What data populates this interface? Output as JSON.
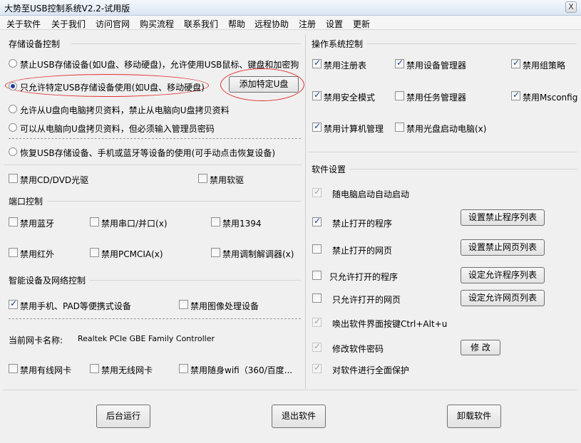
{
  "window": {
    "title": "大势至USB控制系统V2.2-试用版",
    "close": "X"
  },
  "menu": [
    "关于软件",
    "关于我们",
    "访问官网",
    "购买流程",
    "联系我们",
    "帮助",
    "远程协助",
    "注册",
    "设置",
    "更新"
  ],
  "storage": {
    "title": "存储设备控制",
    "opt_disable": "禁止USB存储设备(如U盘、移动硬盘)，允许使用USB鼠标、键盘和加密狗",
    "opt_specific": "只允许特定USB存储设备使用(如U盘、移动硬盘)",
    "add_button": "添加特定U盘",
    "opt_copy_to_pc": "允许从U盘向电脑拷贝资料，禁止从电脑向U盘拷贝资料",
    "opt_copy_pwd": "可以从电脑向U盘拷贝资料，但必须输入管理员密码",
    "opt_restore": "恢复USB存储设备、手机或蓝牙等设备的使用(可手动点击恢复设备)",
    "cd": "禁用CD/DVD光驱",
    "floppy": "禁用软驱"
  },
  "port": {
    "title": "端口控制",
    "bluetooth": "禁用蓝牙",
    "serial": "禁用串口/并口(x)",
    "p1394": "禁用1394",
    "infrared": "禁用红外",
    "pcmcia": "禁用PCMCIA(x)",
    "modem": "禁用调制解调器(x)"
  },
  "smart": {
    "title": "智能设备及网络控制",
    "phone": "禁用手机、PAD等便携式设备",
    "imaging": "禁用图像处理设备",
    "nic_label": "当前网卡名称:",
    "nic_value": "Realtek PCIe GBE Family Controller",
    "wired": "禁用有线网卡",
    "wireless": "禁用无线网卡",
    "wifi": "禁用随身wifi（360/百度..."
  },
  "os": {
    "title": "操作系统控制",
    "registry": "禁用注册表",
    "devmgr": "禁用设备管理器",
    "gpedit": "禁用组策略",
    "safemode": "禁用安全模式",
    "taskmgr": "禁用任务管理器",
    "msconfig": "禁用Msconfig",
    "compmgmt": "禁用计算机管理",
    "cdboot": "禁用光盘启动电脑(x)"
  },
  "settings": {
    "title": "软件设置",
    "autostart": "随电脑启动自动启动",
    "block_programs": "禁止打开的程序",
    "block_programs_btn": "设置禁止程序列表",
    "block_web": "禁止打开的网页",
    "block_web_btn": "设置禁止网页列表",
    "allow_programs": "只允许打开的程序",
    "allow_programs_btn": "设定允许程序列表",
    "allow_web": "只允许打开的网页",
    "allow_web_btn": "设定允许网页列表",
    "hotkey": "唤出软件界面按键Ctrl+Alt+u",
    "password": "修改软件密码",
    "password_btn": "修 改",
    "protect": "对软件进行全面保护"
  },
  "footer": {
    "background": "后台运行",
    "exit": "退出软件",
    "uninstall": "卸载软件"
  }
}
